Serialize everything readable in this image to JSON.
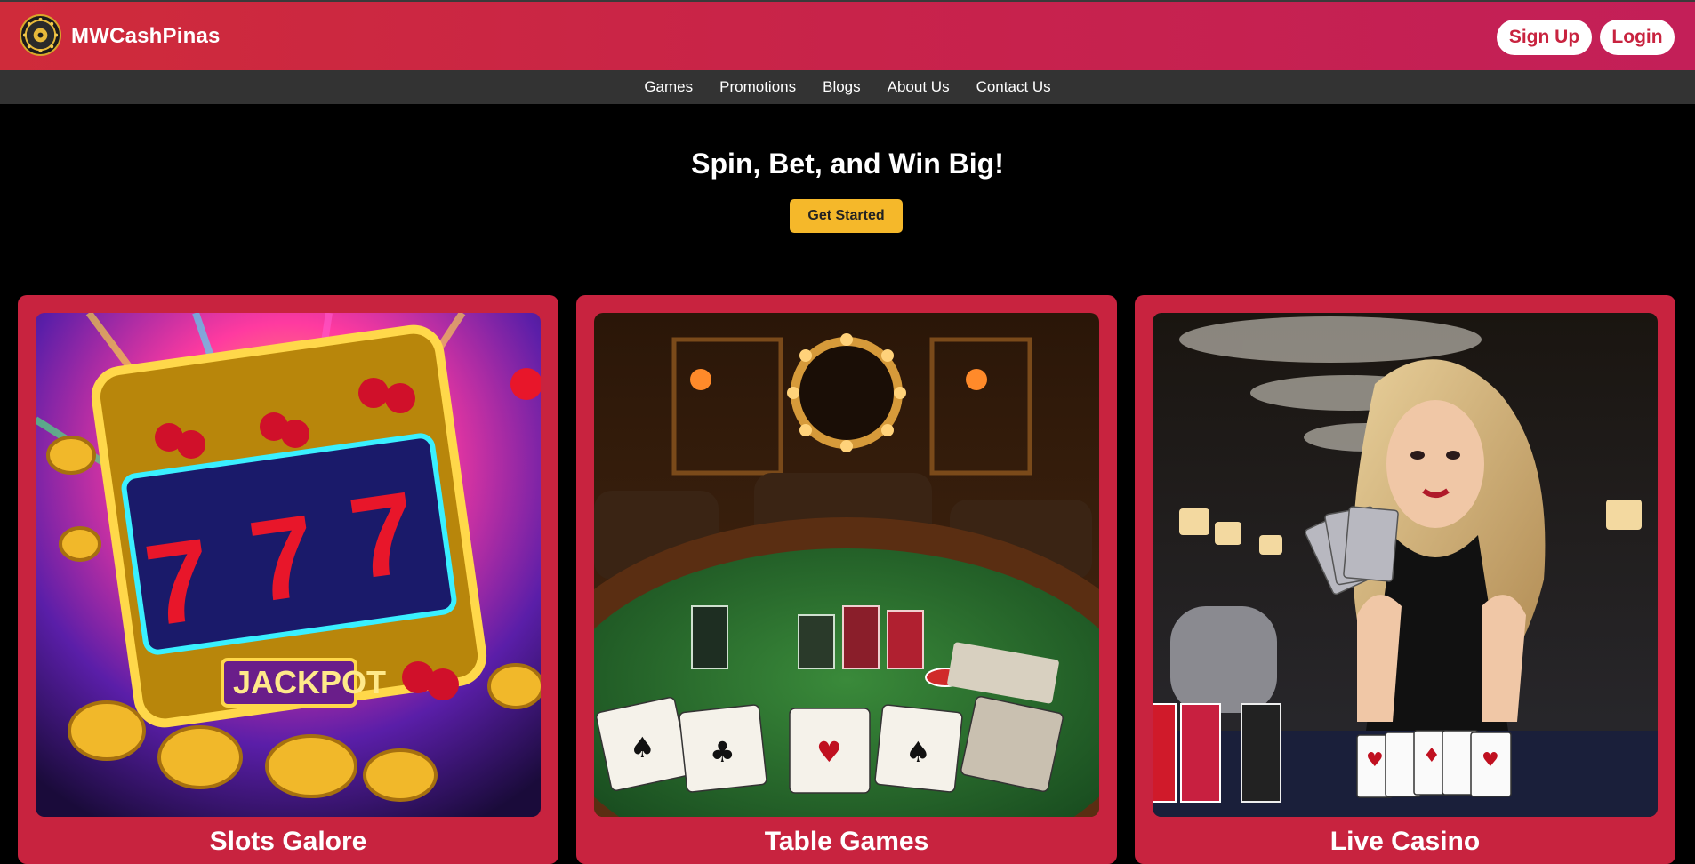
{
  "header": {
    "brand": "MWCashPinas",
    "logo_icon": "roulette-wheel-icon",
    "signup_label": "Sign Up",
    "login_label": "Login",
    "accent_color": "#c8233f"
  },
  "nav": {
    "items": [
      {
        "label": "Games"
      },
      {
        "label": "Promotions"
      },
      {
        "label": "Blogs"
      },
      {
        "label": "About Us"
      },
      {
        "label": "Contact Us"
      }
    ]
  },
  "hero": {
    "title": "Spin, Bet, and Win Big!",
    "cta_label": "Get Started",
    "cta_color": "#f5b82a"
  },
  "cards": [
    {
      "title": "Slots Galore",
      "image": "slot-machine-jackpot-image"
    },
    {
      "title": "Table Games",
      "image": "poker-table-image"
    },
    {
      "title": "Live Casino",
      "image": "live-dealer-image"
    }
  ]
}
